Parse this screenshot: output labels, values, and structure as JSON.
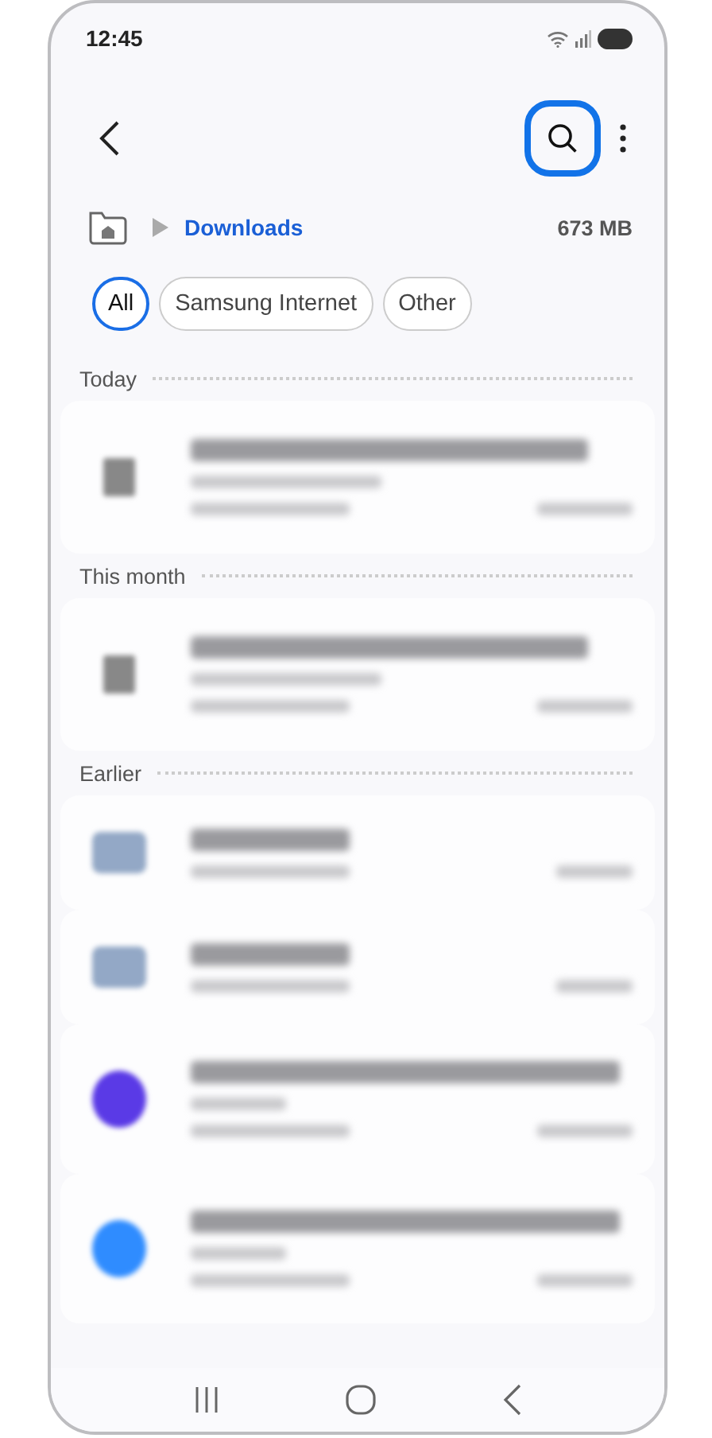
{
  "status_bar": {
    "time": "12:45"
  },
  "toolbar": {
    "search_highlighted": true
  },
  "path": {
    "current": "Downloads",
    "size": "673 MB"
  },
  "filters": [
    {
      "label": "All",
      "selected": true
    },
    {
      "label": "Samsung Internet",
      "selected": false
    },
    {
      "label": "Other",
      "selected": false
    }
  ],
  "sections": [
    {
      "title": "Today",
      "items": [
        {
          "kind": "document"
        }
      ]
    },
    {
      "title": "This month",
      "items": [
        {
          "kind": "document"
        }
      ]
    },
    {
      "title": "Earlier",
      "items": [
        {
          "kind": "folder"
        },
        {
          "kind": "folder"
        },
        {
          "kind": "app",
          "color": "#5a3ae6"
        },
        {
          "kind": "app",
          "color": "#2f8cff"
        }
      ]
    }
  ]
}
